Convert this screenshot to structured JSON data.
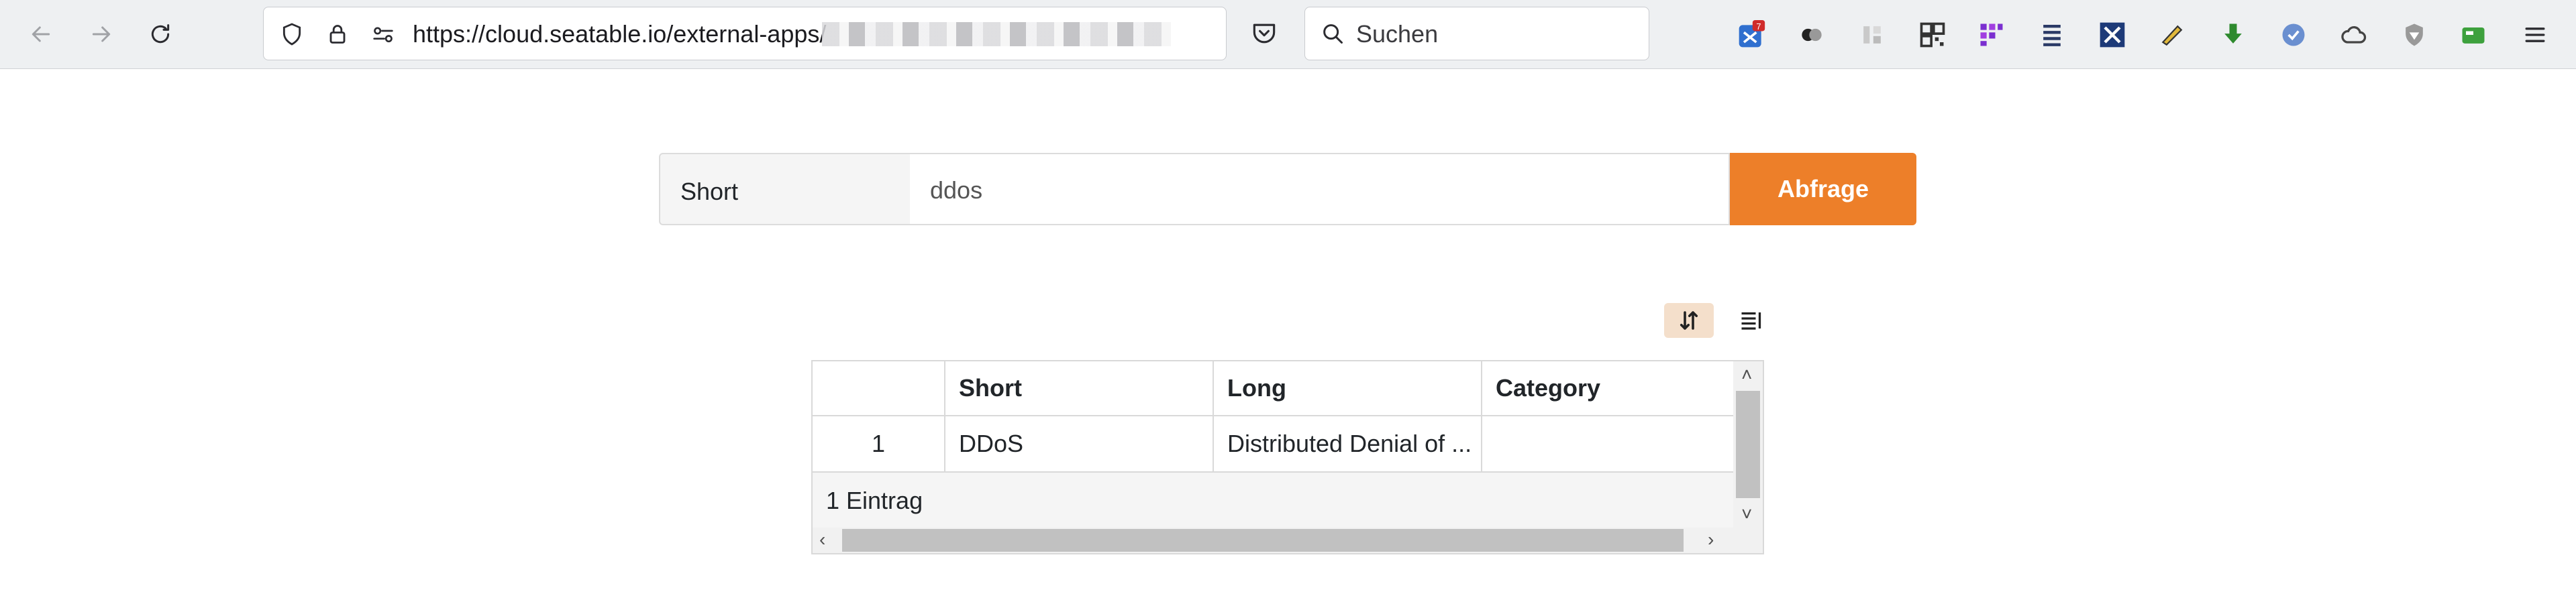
{
  "browser": {
    "url": "https://cloud.seatable.io/external-apps/",
    "search_placeholder": "Suchen",
    "extension_badge": "7"
  },
  "query": {
    "field_label": "Short",
    "input_value": "ddos",
    "button_label": "Abfrage"
  },
  "table": {
    "columns": [
      "",
      "Short",
      "Long",
      "Category"
    ],
    "rows": [
      {
        "index": "1",
        "short": "DDoS",
        "long": "Distributed Denial of ...",
        "category": ""
      }
    ],
    "footer": "1 Eintrag"
  },
  "colors": {
    "accent": "#ed7f29",
    "accent_light": "#f4dfcb",
    "toolbar_bg": "#eef0f2"
  }
}
